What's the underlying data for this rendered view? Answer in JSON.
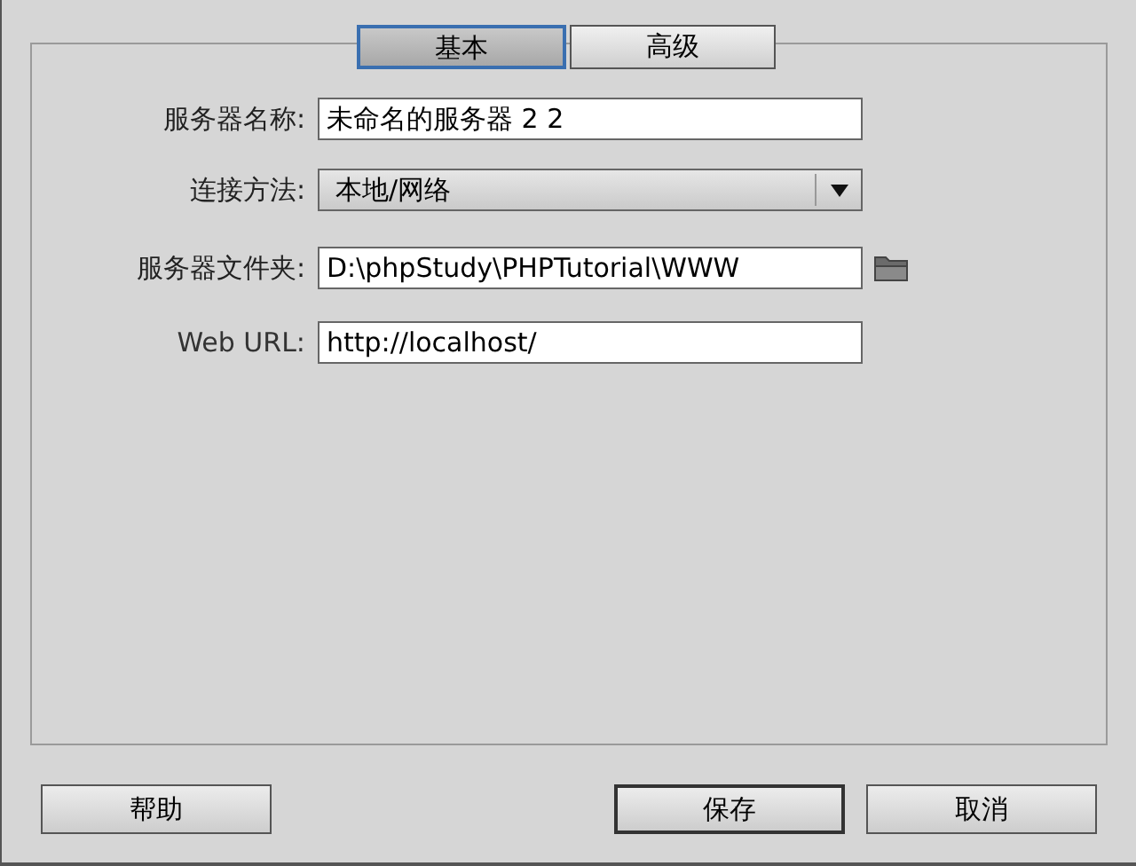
{
  "tabs": [
    {
      "label": "基本",
      "selected": true
    },
    {
      "label": "高级",
      "selected": false
    }
  ],
  "fields": [
    {
      "kind": "text",
      "label": "服务器名称:",
      "value": "未命名的服务器 2 2"
    },
    {
      "kind": "select",
      "label": "连接方法:",
      "value": "本地/网络"
    },
    {
      "kind": "folder",
      "label": "服务器文件夹:",
      "value": "D:\\phpStudy\\PHPTutorial\\WWW"
    },
    {
      "kind": "text",
      "label": "Web URL:",
      "value": "http://localhost/"
    }
  ],
  "buttons": [
    {
      "label": "帮助",
      "default": false
    },
    {
      "label": "保存",
      "default": true
    },
    {
      "label": "取消",
      "default": false
    }
  ]
}
